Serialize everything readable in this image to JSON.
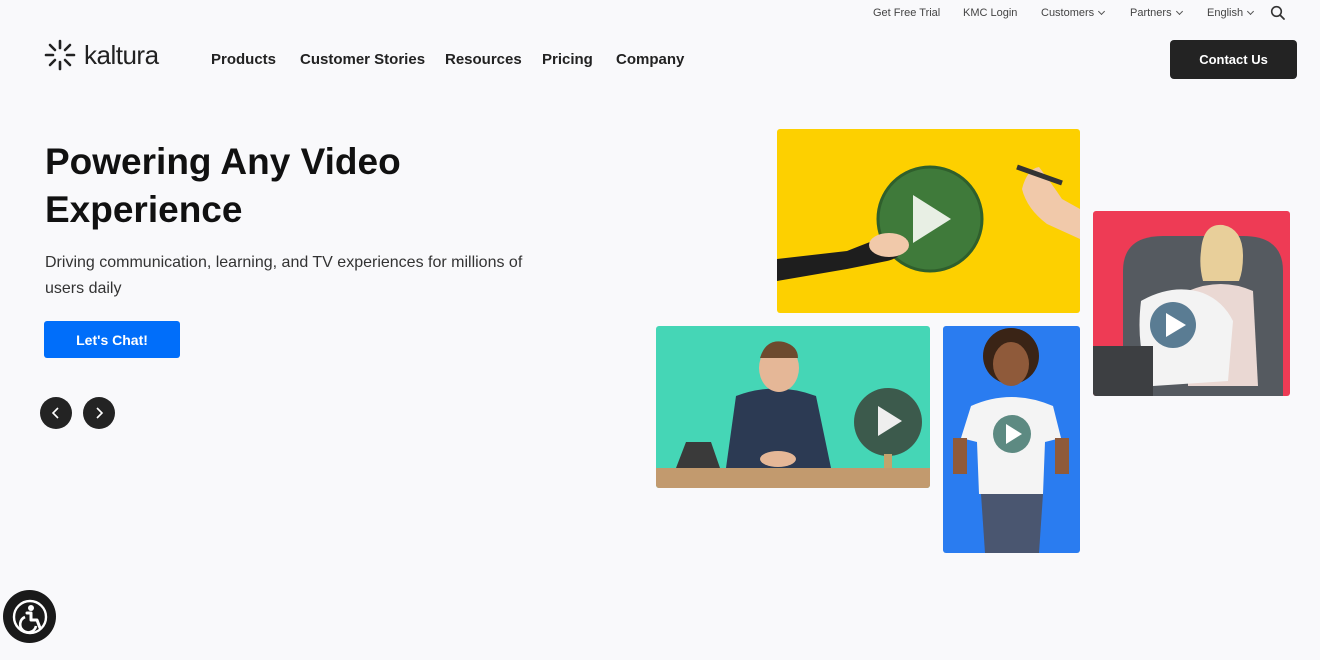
{
  "utility_bar": {
    "free_trial": "Get Free Trial",
    "kmc_login": "KMC Login",
    "customers": "Customers",
    "partners": "Partners",
    "language": "English"
  },
  "brand": {
    "name": "kaltura"
  },
  "nav": {
    "products": "Products",
    "customer_stories": "Customer Stories",
    "resources": "Resources",
    "pricing": "Pricing",
    "company": "Company",
    "contact": "Contact Us"
  },
  "hero": {
    "title": "Powering Any Video Experience",
    "subtitle": "Driving communication, learning, and TV experiences for millions of users daily",
    "cta": "Let's Chat!"
  },
  "colors": {
    "cta_blue": "#006efa",
    "dark": "#232323",
    "tile_yellow": "#fdd000",
    "tile_teal": "#45d6b6",
    "tile_blue": "#2a7cf0",
    "tile_red": "#ee3b55"
  },
  "icons": [
    "search-icon",
    "chevron-down-icon",
    "arrow-left-icon",
    "arrow-right-icon",
    "play-icon",
    "accessibility-icon"
  ]
}
